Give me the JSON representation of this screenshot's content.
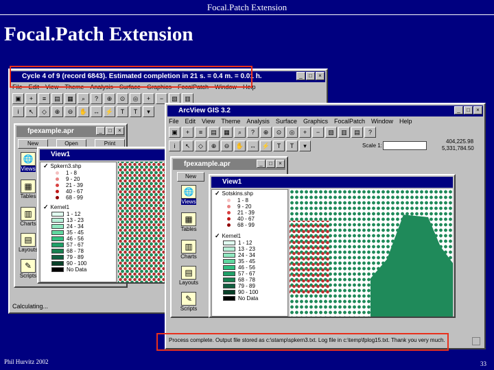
{
  "slide": {
    "header": "Focal.Patch Extension",
    "title": "Focal.Patch Extension",
    "footer_left": "Phil Hurvitz 2002",
    "page_number": "33"
  },
  "window1": {
    "title": "Cycle 4 of 9 (record 6843). Estimated completion in 21 s. = 0.4 m. = 0.01 h.",
    "menu": [
      "File",
      "Edit",
      "View",
      "Theme",
      "Analysis",
      "Surface",
      "Graphics",
      "FocalPatch",
      "Window",
      "Help"
    ],
    "status": "Calculating..."
  },
  "window2": {
    "title": "ArcView GIS 3.2",
    "menu": [
      "File",
      "Edit",
      "View",
      "Theme",
      "Analysis",
      "Surface",
      "Graphics",
      "FocalPatch",
      "Window",
      "Help"
    ],
    "scale_label": "Scale 1:",
    "coords": [
      "404,225.98",
      "5,331,784.50"
    ],
    "status": "Process complete. Output file stored as c:\\stamp\\spkern3.txt. Log file in c:\\temp\\fplog15.txt. Thank you very much."
  },
  "project": {
    "title": "fpexample.apr",
    "buttons": [
      "New",
      "Open",
      "Print"
    ],
    "docs": [
      "Views",
      "Tables",
      "Charts",
      "Layouts",
      "Scripts"
    ]
  },
  "view1_back": {
    "title": "View1",
    "layer1": "Spkern3.shp",
    "layer1_classes": [
      "1 - 8",
      "9 - 20",
      "21 - 39",
      "40 - 67",
      "68 - 99"
    ],
    "layer2": "Kernel1",
    "layer2_classes": [
      "1 - 12",
      "13 - 23",
      "24 - 34",
      "35 - 45",
      "46 - 56",
      "57 - 67",
      "68 - 78",
      "79 - 89",
      "90 - 100",
      "No Data"
    ]
  },
  "view1_front": {
    "title": "View1",
    "layer1": "Sotskins.shp",
    "layer1_classes": [
      "1 - 8",
      "9 - 20",
      "21 - 39",
      "40 - 67",
      "68 - 99"
    ],
    "layer2": "Kernel1",
    "layer2_classes": [
      "1 - 12",
      "13 - 23",
      "24 - 34",
      "35 - 45",
      "46 - 56",
      "57 - 67",
      "68 - 78",
      "79 - 89",
      "90 - 100",
      "No Data"
    ]
  },
  "colors": {
    "background": "#000080",
    "highlight": "#e8301c",
    "map_green": "#1f8a5a"
  }
}
